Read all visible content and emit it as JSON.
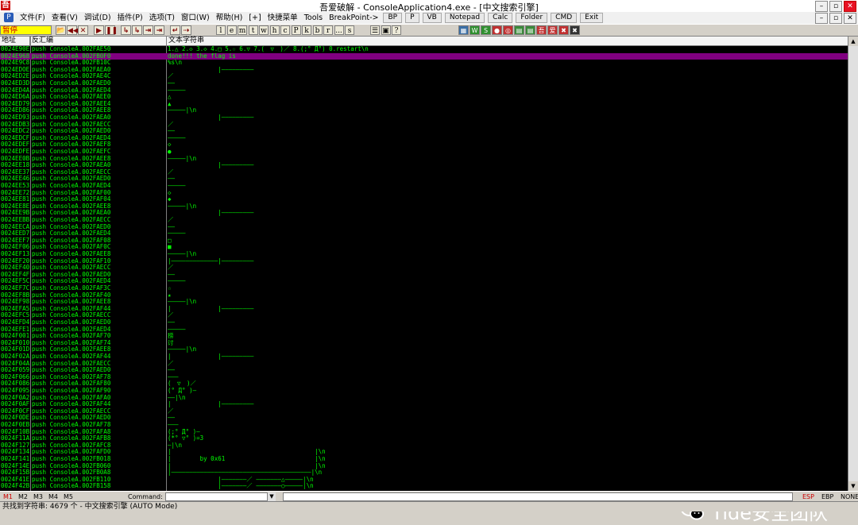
{
  "window": {
    "title": "吾爱破解 - ConsoleApplication4.exe - [中文搜索引擎]",
    "minimize": "–",
    "maximize": "▫",
    "close": "✕"
  },
  "menu": {
    "items": [
      "文件(F)",
      "查看(V)",
      "调试(D)",
      "插件(P)",
      "选项(T)",
      "窗口(W)",
      "帮助(H)",
      "[+]",
      "快捷菜单",
      "Tools",
      "BreakPoint->"
    ],
    "buttons": [
      "BP",
      "P",
      "VB",
      "Notepad",
      "Calc",
      "Folder",
      "CMD",
      "Exit"
    ]
  },
  "toolbar": {
    "status": "暂停",
    "nav_icons": [
      "📂",
      "◀◀",
      "✕",
      "▶",
      "❚❚",
      "↳",
      "↳",
      "⇥",
      "⇥",
      "↵",
      "⇢"
    ],
    "letters": [
      "l",
      "e",
      "m",
      "t",
      "w",
      "h",
      "c",
      "P",
      "k",
      "b",
      "r",
      "...",
      "s"
    ],
    "color_buttons": [
      {
        "label": "▦",
        "color": "#3a6ea5"
      },
      {
        "label": "W",
        "color": "#2f8f2f"
      },
      {
        "label": "S",
        "color": "#2f8f2f"
      },
      {
        "label": "●",
        "color": "#c03030"
      },
      {
        "label": "◎",
        "color": "#c03030"
      },
      {
        "label": "▤",
        "color": "#3a8a3a"
      },
      {
        "label": "▤",
        "color": "#3a8a3a"
      },
      {
        "label": "吾",
        "color": "#c03030"
      },
      {
        "label": "爱",
        "color": "#c03030"
      },
      {
        "label": "✖",
        "color": "#c03030"
      },
      {
        "label": "✖",
        "color": "#333333"
      }
    ]
  },
  "columns": {
    "address": "地址",
    "disasm": "反汇编",
    "text": "文本字符串"
  },
  "rows": [
    {
      "addr": "0024E90E",
      "asm": "push ConsoleA.002FAE50",
      "text": "1.△ 2.◇ 3.◇ 4.□ 5.☆ 6.▽ 7.(￣▽￣)／ 8.(;° Д°) 0.restart\\n",
      "selected": false
    },
    {
      "addr": "0024E968",
      "asm": "push ConsoleA.002FB0F0",
      "text": "done!!! the flag is",
      "selected": true
    },
    {
      "addr": "0024E9C8",
      "asm": "push ConsoleA.002FB10C",
      "text": "%s\\n",
      "selected": false
    },
    {
      "addr": "0024EDOE",
      "asm": "push ConsoleA.002FAEA0",
      "text": "              |—————————",
      "selected": false
    },
    {
      "addr": "0024ED2E",
      "asm": "push ConsoleA.002FAE4C",
      "text": "／",
      "selected": false
    },
    {
      "addr": "0024ED3D",
      "asm": "push ConsoleA.002FAED0",
      "text": "——",
      "selected": false
    },
    {
      "addr": "0024ED4A",
      "asm": "push ConsoleA.002FAED4",
      "text": "—————",
      "selected": false
    },
    {
      "addr": "0024ED6A",
      "asm": "push ConsoleA.002FAEE0",
      "text": "△",
      "selected": false
    },
    {
      "addr": "0024ED79",
      "asm": "push ConsoleA.002FAEE4",
      "text": "▲",
      "selected": false
    },
    {
      "addr": "0024ED86",
      "asm": "push ConsoleA.002FAEE8",
      "text": "—————|\\n",
      "selected": false
    },
    {
      "addr": "0024ED93",
      "asm": "push ConsoleA.002FAEA0",
      "text": "              |—————————",
      "selected": false
    },
    {
      "addr": "0024EDB3",
      "asm": "push ConsoleA.002FAECC",
      "text": "／",
      "selected": false
    },
    {
      "addr": "0024EDC2",
      "asm": "push ConsoleA.002FAED0",
      "text": "——",
      "selected": false
    },
    {
      "addr": "0024EDCF",
      "asm": "push ConsoleA.002FAED4",
      "text": "—————",
      "selected": false
    },
    {
      "addr": "0024EDEF",
      "asm": "push ConsoleA.002FAEF8",
      "text": "◇",
      "selected": false
    },
    {
      "addr": "0024EDFE",
      "asm": "push ConsoleA.002FAEFC",
      "text": "●",
      "selected": false
    },
    {
      "addr": "0024EE0B",
      "asm": "push ConsoleA.002FAEE8",
      "text": "—————|\\n",
      "selected": false
    },
    {
      "addr": "0024EE18",
      "asm": "push ConsoleA.002FAEA0",
      "text": "              |—————————",
      "selected": false
    },
    {
      "addr": "0024EE37",
      "asm": "push ConsoleA.002FAECC",
      "text": "／",
      "selected": false
    },
    {
      "addr": "0024EE46",
      "asm": "push ConsoleA.002FAED0",
      "text": "——",
      "selected": false
    },
    {
      "addr": "0024EE53",
      "asm": "push ConsoleA.002FAED4",
      "text": "—————",
      "selected": false
    },
    {
      "addr": "0024EE72",
      "asm": "push ConsoleA.002FAF00",
      "text": "◇",
      "selected": false
    },
    {
      "addr": "0024EE81",
      "asm": "push ConsoleA.002FAF04",
      "text": "◆",
      "selected": false
    },
    {
      "addr": "0024EE8E",
      "asm": "push ConsoleA.002FAEE8",
      "text": "—————|\\n",
      "selected": false
    },
    {
      "addr": "0024EE9B",
      "asm": "push ConsoleA.002FAEA0",
      "text": "              |—————————",
      "selected": false
    },
    {
      "addr": "0024EEBB",
      "asm": "push ConsoleA.002FAECC",
      "text": "／",
      "selected": false
    },
    {
      "addr": "0024EECA",
      "asm": "push ConsoleA.002FAED0",
      "text": "——",
      "selected": false
    },
    {
      "addr": "0024EED7",
      "asm": "push ConsoleA.002FAED4",
      "text": "—————",
      "selected": false
    },
    {
      "addr": "0024EEF7",
      "asm": "push ConsoleA.002FAF08",
      "text": "□",
      "selected": false
    },
    {
      "addr": "0024EF06",
      "asm": "push ConsoleA.002FAF0C",
      "text": "■",
      "selected": false
    },
    {
      "addr": "0024EF13",
      "asm": "push ConsoleA.002FAEE8",
      "text": "—————|\\n",
      "selected": false
    },
    {
      "addr": "0024EF20",
      "asm": "push ConsoleA.002FAF10",
      "text": "|—————————————|—————————",
      "selected": false
    },
    {
      "addr": "0024EF40",
      "asm": "push ConsoleA.002FAECC",
      "text": "／",
      "selected": false
    },
    {
      "addr": "0024EF4F",
      "asm": "push ConsoleA.002FAED0",
      "text": "——",
      "selected": false
    },
    {
      "addr": "0024EF5C",
      "asm": "push ConsoleA.002FAED4",
      "text": "—————",
      "selected": false
    },
    {
      "addr": "0024EF7C",
      "asm": "push ConsoleA.002FAF3C",
      "text": "☆",
      "selected": false
    },
    {
      "addr": "0024EF8B",
      "asm": "push ConsoleA.002FAF40",
      "text": "★",
      "selected": false
    },
    {
      "addr": "0024EF98",
      "asm": "push ConsoleA.002FAEE8",
      "text": "—————|\\n",
      "selected": false
    },
    {
      "addr": "0024EFA5",
      "asm": "push ConsoleA.002FAF44",
      "text": "|             |—————————",
      "selected": false
    },
    {
      "addr": "0024EFC5",
      "asm": "push ConsoleA.002FAECC",
      "text": "／",
      "selected": false
    },
    {
      "addr": "0024EFD4",
      "asm": "push ConsoleA.002FAED0",
      "text": "——",
      "selected": false
    },
    {
      "addr": "0024EFE1",
      "asm": "push ConsoleA.002FAED4",
      "text": "—————",
      "selected": false
    },
    {
      "addr": "0024F001",
      "asm": "push ConsoleA.002FAF70",
      "text": "捞",
      "selected": false
    },
    {
      "addr": "0024F010",
      "asm": "push ConsoleA.002FAF74",
      "text": "讨",
      "selected": false
    },
    {
      "addr": "0024F01D",
      "asm": "push ConsoleA.002FAEE8",
      "text": "—————|\\n",
      "selected": false
    },
    {
      "addr": "0024F02A",
      "asm": "push ConsoleA.002FAF44",
      "text": "|             |—————————",
      "selected": false
    },
    {
      "addr": "0024F04A",
      "asm": "push ConsoleA.002FAECC",
      "text": "／",
      "selected": false
    },
    {
      "addr": "0024F059",
      "asm": "push ConsoleA.002FAED0",
      "text": "——",
      "selected": false
    },
    {
      "addr": "0024F066",
      "asm": "push ConsoleA.002FAF78",
      "text": "———",
      "selected": false
    },
    {
      "addr": "0024F086",
      "asm": "push ConsoleA.002FAF80",
      "text": "(￣▽￣)／",
      "selected": false
    },
    {
      "addr": "0024F095",
      "asm": "push ConsoleA.002FAF90",
      "text": "(° Д° )—",
      "selected": false
    },
    {
      "addr": "0024F0A2",
      "asm": "push ConsoleA.002FAFA0",
      "text": "——|\\n",
      "selected": false
    },
    {
      "addr": "0024F0AF",
      "asm": "push ConsoleA.002FAF44",
      "text": "|             |—————————",
      "selected": false
    },
    {
      "addr": "0024F0CF",
      "asm": "push ConsoleA.002FAECC",
      "text": "／",
      "selected": false
    },
    {
      "addr": "0024F0DE",
      "asm": "push ConsoleA.002FAED0",
      "text": "——",
      "selected": false
    },
    {
      "addr": "0024F0EB",
      "asm": "push ConsoleA.002FAF78",
      "text": "———",
      "selected": false
    },
    {
      "addr": "0024F10B",
      "asm": "push ConsoleA.002FAFA8",
      "text": "(;° Д° )—",
      "selected": false
    },
    {
      "addr": "0024F11A",
      "asm": "push ConsoleA.002FAFB8",
      "text": "(*° ▽° )=3",
      "selected": false
    },
    {
      "addr": "0024F127",
      "asm": "push ConsoleA.002FAFC8",
      "text": "—|\\n",
      "selected": false
    },
    {
      "addr": "0024F134",
      "asm": "push ConsoleA.002FAFD0",
      "text": "|                                        |\\n",
      "selected": false
    },
    {
      "addr": "0024F141",
      "asm": "push ConsoleA.002FB018",
      "text": "|        by 0x61                         |\\n",
      "selected": false
    },
    {
      "addr": "0024F14E",
      "asm": "push ConsoleA.002FB060",
      "text": "|                                        |\\n",
      "selected": false
    },
    {
      "addr": "0024F15B",
      "asm": "push ConsoleA.002FB0A8",
      "text": "|———————————————————————————————————————|\\n",
      "selected": false
    },
    {
      "addr": "0024F41E",
      "asm": "push ConsoleA.002FB110",
      "text": "              |———————／ ———————△—————|\\n",
      "selected": false
    },
    {
      "addr": "0024F42B",
      "asm": "push ConsoleA.002FB158",
      "text": "              |———————／ ———————○—————|\\n",
      "selected": false
    }
  ],
  "command": {
    "markers": [
      "M1",
      "M2",
      "M3",
      "M4",
      "M5"
    ],
    "label": "Command:",
    "input_value": "",
    "dropdown_icon": "▼",
    "registers": [
      "ESP",
      "EBP",
      "NONE"
    ]
  },
  "status": {
    "text": "共找到字符串: 4679 个 - 中文搜索引擎 (AUTO Mode)"
  },
  "watermark": {
    "text": "Tide安全团队"
  },
  "colors": {
    "list_text": "#00ff00",
    "selected_row": "#800080",
    "list_background": "#000000"
  }
}
